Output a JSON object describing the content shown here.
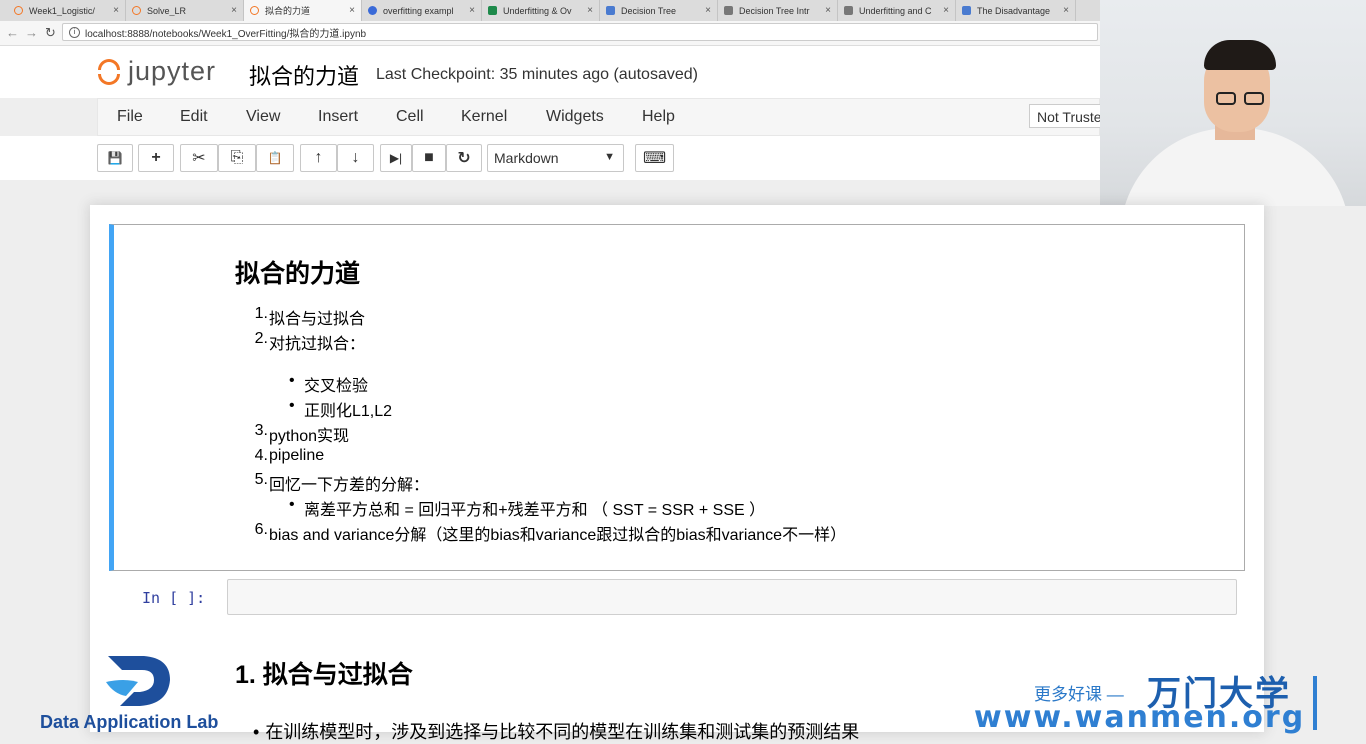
{
  "browser": {
    "tabs": [
      {
        "label": "Week1_Logistic/",
        "icon": "jupyter-icon"
      },
      {
        "label": "Solve_LR",
        "icon": "jupyter-icon"
      },
      {
        "label": "拟合的力道",
        "icon": "jupyter-icon"
      },
      {
        "label": "overfitting exampl",
        "icon": "paw-icon"
      },
      {
        "label": "Underfitting & Ov",
        "icon": "sheet-icon"
      },
      {
        "label": "Decision Tree",
        "icon": "page-icon"
      },
      {
        "label": "Decision Tree Intr",
        "icon": "doc-icon"
      },
      {
        "label": "Underfitting and C",
        "icon": "doc-icon"
      },
      {
        "label": "The Disadvantage",
        "icon": "page-icon"
      }
    ],
    "url": "localhost:8888/notebooks/Week1_OverFitting/拟合的力道.ipynb"
  },
  "header": {
    "logo_text": "jupyter",
    "notebook_title": "拟合的力道",
    "checkpoint": "Last Checkpoint: 35 minutes ago (autosaved)",
    "trust": "Not Truste"
  },
  "menu": [
    "File",
    "Edit",
    "View",
    "Insert",
    "Cell",
    "Kernel",
    "Widgets",
    "Help"
  ],
  "toolbar": {
    "cell_type": "Markdown",
    "icons": {
      "save": "💾",
      "add": "+",
      "cut": "✂",
      "copy": "⎘",
      "paste": "📋",
      "up": "↑",
      "down": "↓",
      "run": "▶|",
      "stop": "■",
      "restart": "↻",
      "keyboard": "⌨"
    }
  },
  "markdown_cell": {
    "title": "拟合的力道",
    "items": [
      {
        "num": "1.",
        "text": "拟合与过拟合"
      },
      {
        "num": "2.",
        "text": "对抗过拟合："
      },
      {
        "num": "3.",
        "text": "python实现"
      },
      {
        "num": "4.",
        "text": "pipeline"
      },
      {
        "num": "5.",
        "text": "回忆一下方差的分解："
      },
      {
        "num": "6.",
        "text": "bias and variance分解（这里的bias和variance跟过拟合的bias和variance不一样）"
      }
    ],
    "sub2": [
      "交叉检验",
      "正则化L1,L2"
    ],
    "sub5": [
      "离差平方总和 = 回归平方和+残差平方和 （ SST = SSR + SSE ）"
    ]
  },
  "code_cell": {
    "prompt": "In [ ]:"
  },
  "section": {
    "heading": "1. 拟合与过拟合",
    "text": "在训练模型时，涉及到选择与比较不同的模型在训练集和测试集的预测结果"
  },
  "watermarks": {
    "lab": "Data Application Lab",
    "slogan": "更多好课 —",
    "brand": "万门大学",
    "url": "www.wanmen.org"
  }
}
